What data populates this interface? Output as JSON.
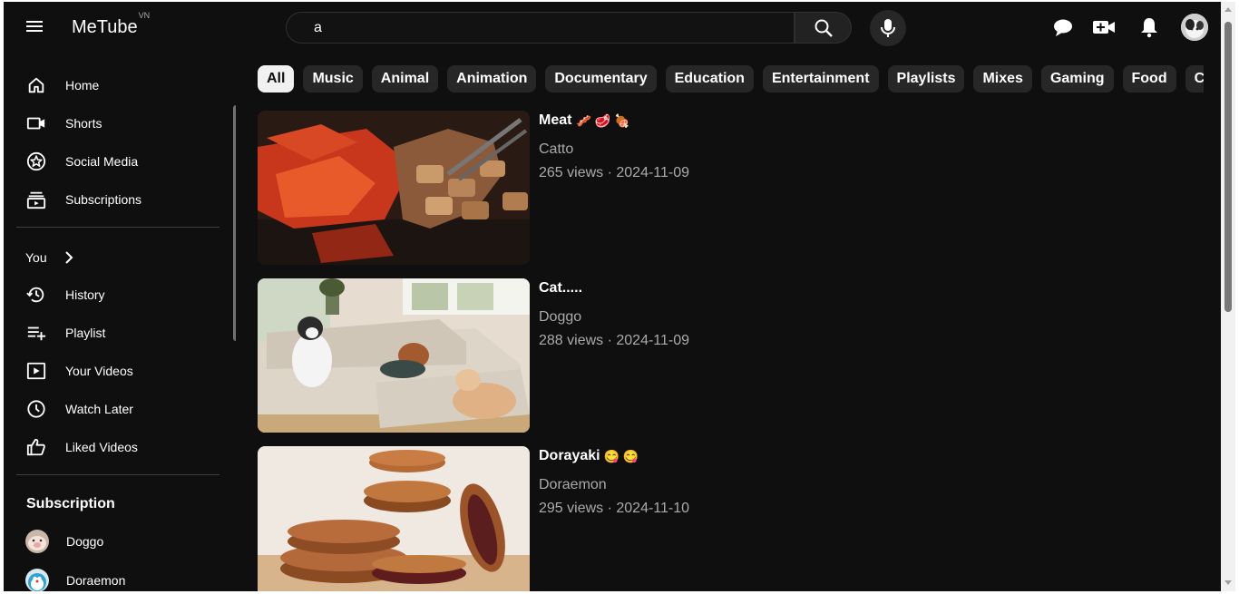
{
  "app": {
    "logo": "MeTube",
    "logo_region": "VN"
  },
  "search": {
    "value": "a"
  },
  "sidebar": {
    "main": [
      {
        "label": "Home",
        "icon": "home-icon"
      },
      {
        "label": "Shorts",
        "icon": "shorts-icon"
      },
      {
        "label": "Social Media",
        "icon": "star-icon"
      },
      {
        "label": "Subscriptions",
        "icon": "subscriptions-icon"
      }
    ],
    "you_label": "You",
    "you": [
      {
        "label": "History",
        "icon": "history-icon"
      },
      {
        "label": "Playlist",
        "icon": "playlist-add-icon"
      },
      {
        "label": "Your Videos",
        "icon": "your-videos-icon"
      },
      {
        "label": "Watch Later",
        "icon": "clock-icon"
      },
      {
        "label": "Liked Videos",
        "icon": "thumbs-up-icon"
      }
    ],
    "subscription_title": "Subscription",
    "subscriptions": [
      {
        "label": "Doggo"
      },
      {
        "label": "Doraemon"
      }
    ]
  },
  "chips": [
    "All",
    "Music",
    "Animal",
    "Animation",
    "Documentary",
    "Education",
    "Entertainment",
    "Playlists",
    "Mixes",
    "Gaming",
    "Food",
    "C"
  ],
  "videos": [
    {
      "title": "Meat",
      "emojis": "🥓 🥩 🍖",
      "channel": "Catto",
      "meta": "265 views · 2024-11-09"
    },
    {
      "title": "Cat.....",
      "emojis": "",
      "channel": "Doggo",
      "meta": "288 views · 2024-11-09"
    },
    {
      "title": "Dorayaki",
      "emojis": "😋 😋",
      "channel": "Doraemon",
      "meta": "295 views · 2024-11-10"
    }
  ]
}
